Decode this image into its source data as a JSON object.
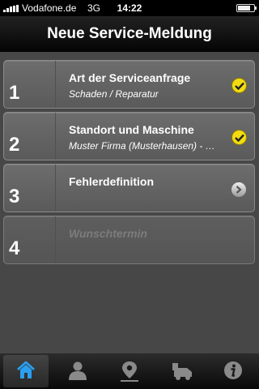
{
  "status_bar": {
    "carrier": "Vodafone.de",
    "network": "3G",
    "time": "14:22"
  },
  "nav": {
    "title": "Neue Service-Meldung"
  },
  "steps": [
    {
      "number": "1",
      "title": "Art der Serviceanfrage",
      "subtitle": "Schaden / Reparatur",
      "state": "check"
    },
    {
      "number": "2",
      "title": "Standort und Maschine",
      "subtitle": "Muster Firma (Musterhausen) - …",
      "state": "check"
    },
    {
      "number": "3",
      "title": "Fehlerdefinition",
      "subtitle": "",
      "state": "chevron"
    },
    {
      "number": "4",
      "title": "Wunschtermin",
      "subtitle": "",
      "state": "disabled"
    }
  ],
  "tabbar": {
    "active": "home",
    "tabs": [
      {
        "icon": "home-icon"
      },
      {
        "icon": "person-icon"
      },
      {
        "icon": "location-pin-icon"
      },
      {
        "icon": "machine-icon"
      },
      {
        "icon": "info-icon"
      }
    ]
  },
  "colors": {
    "check_yellow": "#f2dc11",
    "active_tab_blue": "#2a9ff0"
  }
}
